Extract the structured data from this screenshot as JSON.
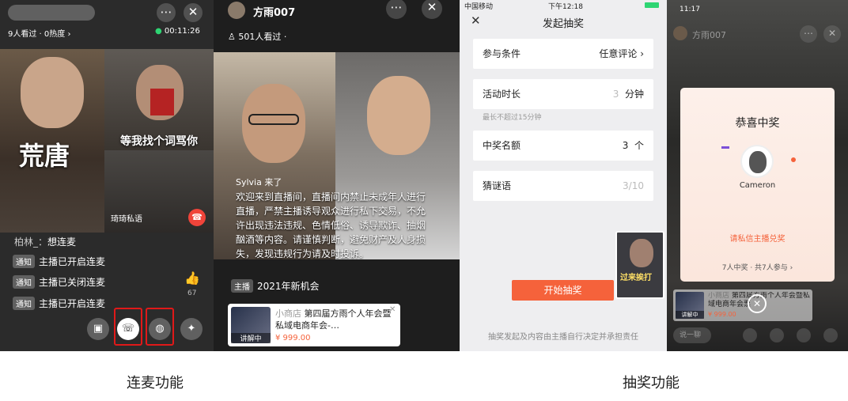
{
  "p1": {
    "viewers": "9人看过 · 0热度 ›",
    "timer": "00:11:26",
    "big_title": "荒唐",
    "subtitle": "等我找个词骂你",
    "private_msg": "琦琦私语",
    "user_line": {
      "name": "柏林_",
      "text": "想连麦"
    },
    "notices": [
      {
        "tag": "通知",
        "text": "主播已开启连麦"
      },
      {
        "tag": "通知",
        "text": "主播已关闭连麦"
      },
      {
        "tag": "通知",
        "text": "主播已开启连麦"
      }
    ],
    "like_count": "67",
    "more_icon": "more-icon",
    "close_icon": "close-icon"
  },
  "p2": {
    "host_name": "方雨007",
    "viewers": "501人看过 ·",
    "join_msg": "Sylvia 来了",
    "notice": "欢迎来到直播间，直播间内禁止未成年人进行直播，严禁主播诱导观众进行私下交易，不允许出现违法违规、色情低俗、诱导欺诈、抽烟酗酒等内容。请谨慎判断，避免财产及人身损失，发现违规行为请及时投诉。",
    "host_tag": "主播",
    "host_msg": "2021年新机会",
    "product": {
      "shop": "小商店",
      "title": "第四届方雨个人年会暨私域电商年会-…",
      "price": "¥ 999.00",
      "status": "讲解中"
    }
  },
  "p3": {
    "status_bar": {
      "carrier": "中国移动",
      "time": "下午12:18"
    },
    "title": "发起抽奖",
    "rows": [
      {
        "label": "参与条件",
        "value": "任意评论 ›"
      },
      {
        "label": "活动时长",
        "value": "3",
        "unit": "分钟",
        "hint": "最长不超过15分钟"
      },
      {
        "label": "中奖名额",
        "value": "3",
        "unit": "个"
      },
      {
        "label": "猜谜语",
        "value": "3/10"
      }
    ],
    "start_button": "开始抽奖",
    "footer": "抽奖发起及内容由主播自行决定并承担责任",
    "video_caption": "过来挨打"
  },
  "p4": {
    "status_time": "11:17",
    "host_name": "方雨007",
    "modal_title": "恭喜中奖",
    "winner_name": "Cameron",
    "link": "请私信主播兑奖",
    "summary": "7人中奖 · 共7人参与 ›",
    "product": {
      "shop": "小商店",
      "title": "第四届方雨个人年会暨私域电商年会票",
      "price": "¥ 999.00",
      "status": "讲解中"
    },
    "input_placeholder": "说一聊"
  },
  "captions": {
    "left": "连麦功能",
    "right": "抽奖功能"
  },
  "colors": {
    "accent": "#f5623b",
    "highlight": "#e01919"
  }
}
